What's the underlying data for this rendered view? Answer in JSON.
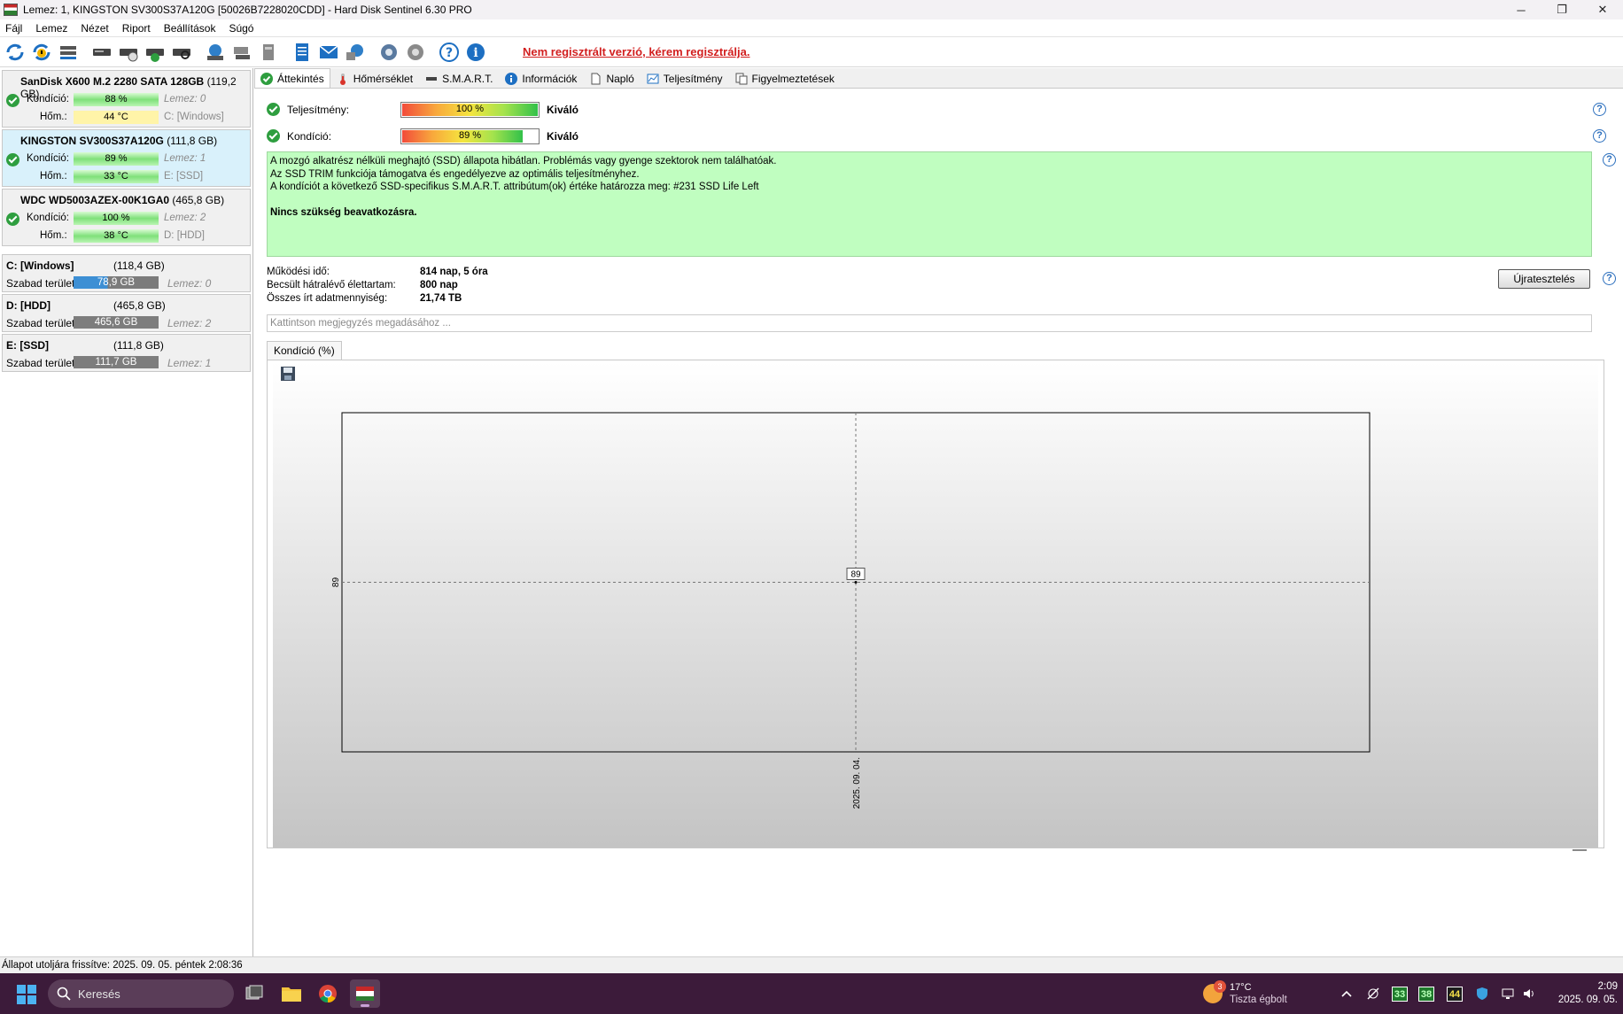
{
  "window": {
    "title": "Lemez: 1, KINGSTON SV300S37A120G [50026B7228020CDD]  -  Hard Disk Sentinel 6.30 PRO",
    "controls": [
      "─",
      "❐",
      "✕"
    ]
  },
  "menu": [
    "Fájl",
    "Lemez",
    "Nézet",
    "Riport",
    "Beállítások",
    "Súgó"
  ],
  "toolbar": {
    "unregistered_notice": "Nem regisztrált verzió, kérem regisztrálja."
  },
  "disks": [
    {
      "name": "SanDisk X600 M.2 2280 SATA 128GB",
      "size": "(119,2 GB)",
      "health_label": "Kondíció:",
      "health": "88 %",
      "health_pct": 88,
      "disk_ref": "Lemez: 0",
      "temp_label": "Hőm.:",
      "temp": "44 °C",
      "temp_level": "warm",
      "volume": "C: [Windows]",
      "selected": false
    },
    {
      "name": "KINGSTON SV300S37A120G",
      "size": "(111,8 GB)",
      "health_label": "Kondíció:",
      "health": "89 %",
      "health_pct": 89,
      "disk_ref": "Lemez: 1",
      "temp_label": "Hőm.:",
      "temp": "33 °C",
      "temp_level": "ok",
      "volume": "E: [SSD]",
      "selected": true
    },
    {
      "name": "WDC WD5003AZEX-00K1GA0",
      "size": "(465,8 GB)",
      "health_label": "Kondíció:",
      "health": "100 %",
      "health_pct": 100,
      "disk_ref": "Lemez: 2",
      "temp_label": "Hőm.:",
      "temp": "38 °C",
      "temp_level": "ok",
      "volume": "D: [HDD]",
      "selected": false
    }
  ],
  "volumes": [
    {
      "name": "C: [Windows]",
      "size": "(118,4 GB)",
      "free_label": "Szabad terület",
      "free": "78,9 GB",
      "free_fraction": 0.67,
      "disk_ref": "Lemez: 0",
      "bar_color": "blue"
    },
    {
      "name": "D: [HDD]",
      "size": "(465,8 GB)",
      "free_label": "Szabad terület",
      "free": "465,6 GB",
      "free_fraction": 1.0,
      "disk_ref": "Lemez: 2",
      "bar_color": "gray"
    },
    {
      "name": "E: [SSD]",
      "size": "(111,8 GB)",
      "free_label": "Szabad terület",
      "free": "111,7 GB",
      "free_fraction": 1.0,
      "disk_ref": "Lemez: 1",
      "bar_color": "gray"
    }
  ],
  "tabs": [
    {
      "label": "Áttekintés",
      "icon": "check-icon",
      "active": true
    },
    {
      "label": "Hőmérséklet",
      "icon": "thermometer-icon",
      "active": false
    },
    {
      "label": "S.M.A.R.T.",
      "icon": "drive-icon",
      "active": false
    },
    {
      "label": "Információk",
      "icon": "info-icon",
      "active": false
    },
    {
      "label": "Napló",
      "icon": "document-icon",
      "active": false
    },
    {
      "label": "Teljesítmény",
      "icon": "performance-chart-icon",
      "active": false
    },
    {
      "label": "Figyelmeztetések",
      "icon": "alerts-icon",
      "active": false
    }
  ],
  "overview": {
    "performance": {
      "label": "Teljesítmény:",
      "value": "100 %",
      "pct": 100,
      "rating": "Kiváló"
    },
    "health": {
      "label": "Kondíció:",
      "value": "89 %",
      "pct": 89,
      "rating": "Kiváló"
    },
    "status_lines": [
      "A mozgó alkatrész nélküli meghajtó (SSD) állapota hibátlan. Problémás vagy gyenge szektorok nem találhatóak.",
      "Az SSD TRIM funkciója támogatva és engedélyezve az optimális teljesítményhez.",
      "A kondíciót a következő SSD-specifikus S.M.A.R.T. attribútum(ok) értéke határozza meg:  #231 SSD Life Left"
    ],
    "status_conclusion": "Nincs szükség beavatkozásra.",
    "status_color": "#c0fec0",
    "info": [
      {
        "key": "Működési idő:",
        "value": "814 nap, 5 óra"
      },
      {
        "key": "Becsült hátralévő élettartam:",
        "value": "800 nap"
      },
      {
        "key": "Összes írt adatmennyiség:",
        "value": "21,74 TB"
      }
    ],
    "retest_label": "Újratesztelés",
    "note_placeholder": "Kattintson megjegyzés megadásához ...",
    "chart_tab": "Kondíció  (%)"
  },
  "chart_data": {
    "type": "line",
    "title": "Kondíció  (%)",
    "x": [
      "2025. 09. 04."
    ],
    "series": [
      {
        "values": [
          89
        ]
      }
    ],
    "y_tick_labels": [
      "89"
    ],
    "point_labels": [
      "89"
    ],
    "grid": true
  },
  "statusbar": {
    "text": "Állapot utoljára frissítve: 2025. 09. 05. péntek 2:08:36"
  },
  "taskbar": {
    "search_placeholder": "Keresés",
    "weather_badge": "3",
    "weather_temp": "17°C",
    "weather_desc": "Tiszta égbolt",
    "tray_temps": [
      "33",
      "38",
      "44"
    ],
    "time": "2:09",
    "date": "2025. 09. 05."
  }
}
